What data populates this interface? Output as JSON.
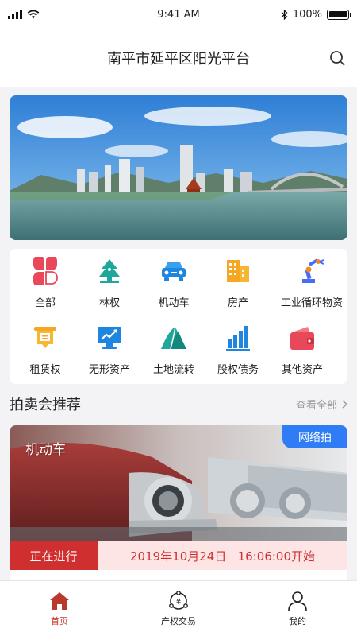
{
  "status_bar": {
    "time": "9:41 AM",
    "battery": "100%",
    "battery_level": 1.0
  },
  "header": {
    "title": "南平市延平区阳光平台"
  },
  "banner": {
    "icon": "city-river-photo"
  },
  "categories": [
    {
      "label": "全部",
      "icon": "four-petal-icon"
    },
    {
      "label": "林权",
      "icon": "pine-tree-icon"
    },
    {
      "label": "机动车",
      "icon": "car-icon"
    },
    {
      "label": "房产",
      "icon": "buildings-icon"
    },
    {
      "label": "工业循环物资",
      "icon": "robot-arm-icon"
    },
    {
      "label": "租赁权",
      "icon": "lease-scroll-icon"
    },
    {
      "label": "无形资产",
      "icon": "monitor-chart-icon"
    },
    {
      "label": "土地流转",
      "icon": "mountains-icon"
    },
    {
      "label": "股权债务",
      "icon": "bar-chart-icon"
    },
    {
      "label": "其他资产",
      "icon": "wallet-icon"
    }
  ],
  "section": {
    "title": "拍卖会推荐",
    "more_label": "查看全部"
  },
  "auction_card": {
    "category": "机动车",
    "tag": "网络拍",
    "status": "正在进行",
    "start_time": "2019年10月24日   16:06:00开始",
    "image": "vintage-cars-photo"
  },
  "tabbar": {
    "items": [
      {
        "label": "首页",
        "icon": "home-icon",
        "active": true
      },
      {
        "label": "产权交易",
        "icon": "property-exchange-icon",
        "active": false
      },
      {
        "label": "我的",
        "icon": "person-icon",
        "active": false
      }
    ]
  },
  "colors": {
    "accent": "#c0392b",
    "status_red": "#cf2f2e",
    "tag_blue": "#2f7cf6",
    "time_bg": "#fde5e6"
  }
}
